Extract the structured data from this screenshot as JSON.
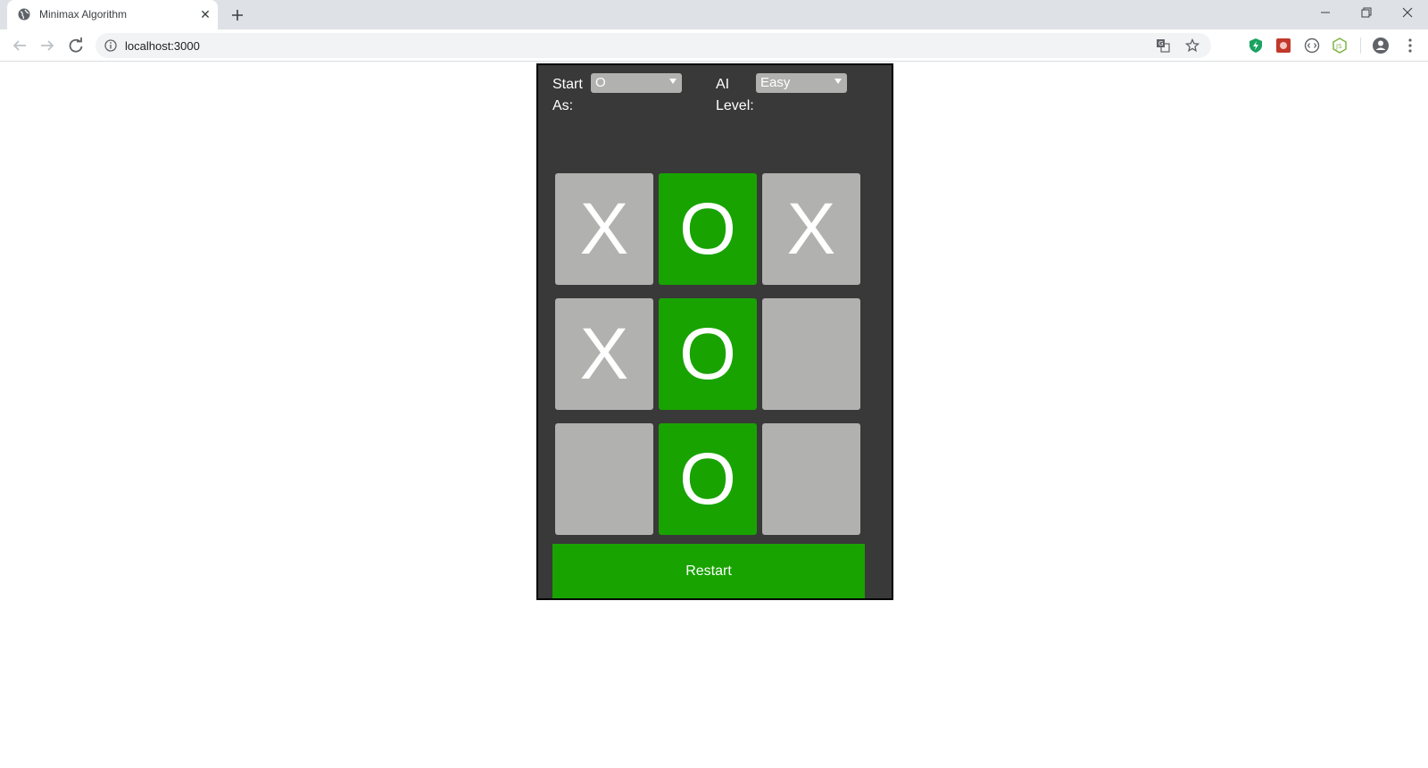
{
  "browser": {
    "tab_title": "Minimax Algorithm",
    "url": "localhost:3000"
  },
  "controls": {
    "start_label": "Start As:",
    "start_label_line1": "Start",
    "start_label_line2": "As:",
    "start_value": "O",
    "level_label_line1": "AI",
    "level_label_line2": "Level:",
    "level_value": "Easy"
  },
  "board": {
    "cells": [
      "X",
      "O",
      "X",
      "X",
      "O",
      "",
      "",
      "O",
      ""
    ],
    "winning_cells": [
      1,
      4,
      7
    ],
    "cell_color": "#b1b2af",
    "win_color": "#18a300"
  },
  "restart_label": "Restart",
  "colors": {
    "panel_bg": "#393939",
    "accent": "#18a300"
  }
}
